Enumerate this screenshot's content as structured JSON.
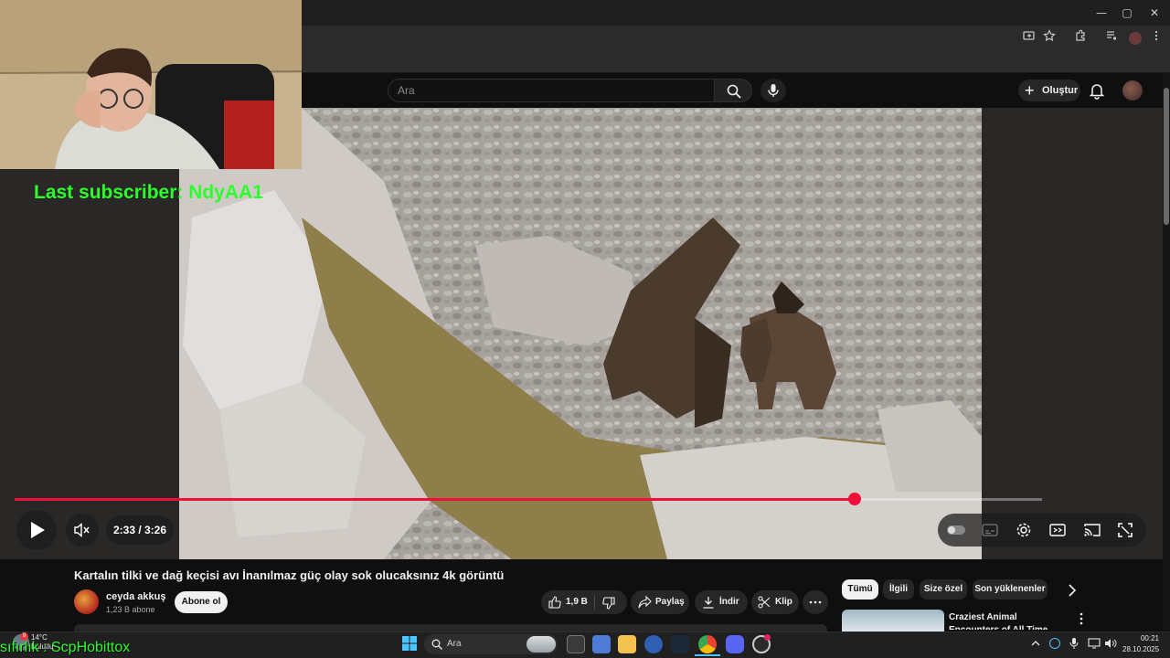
{
  "browser": {
    "window_controls": {
      "minimize": "—",
      "maximize": "▢",
      "close": "✕"
    }
  },
  "header": {
    "search_placeholder": "Ara",
    "create_label": "Oluştur",
    "icons": [
      "search-icon",
      "mic-icon",
      "plus-icon",
      "bell-icon",
      "avatar"
    ]
  },
  "overlay": {
    "last_subscriber": "Last subscriber: NdyAA1",
    "bottom_text": "sıfırlık : ScpHobittox"
  },
  "player": {
    "current_time": "2:33 / 3:26",
    "progress_fraction": 0.818,
    "accent_color": "#f00f3a"
  },
  "video": {
    "title": "Kartalın tilki ve dağ keçisi avı İnanılmaz güç olay sok olucaksınız 4k görüntü",
    "channel": "ceyda akkuş",
    "subscribers": "1,23 B abone",
    "subscribe_label": "Abone ol",
    "like_count": "1,9 B",
    "share_label": "Paylaş",
    "download_label": "İndir",
    "clip_label": "Klip"
  },
  "related": {
    "chips": [
      {
        "label": "Tümü",
        "active": true
      },
      {
        "label": "İlgili",
        "active": false
      },
      {
        "label": "Size özel",
        "active": false
      },
      {
        "label": "Son yüklenenler",
        "active": false
      }
    ],
    "first_title": "Craziest Animal Encounters of All Time"
  },
  "taskbar": {
    "search_label": "Ara",
    "weather_temp": "14°C",
    "weather_desc": "Bulutlu",
    "time": "00:21",
    "date": "28.10.2025"
  }
}
